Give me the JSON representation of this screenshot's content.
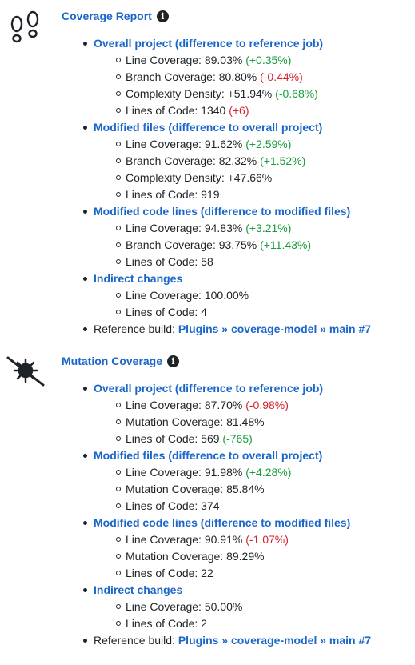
{
  "coverage": {
    "title": "Coverage Report",
    "icon": "footsteps-icon",
    "groups": [
      {
        "title": "Overall project (difference to reference job)",
        "items": [
          {
            "label": "Line Coverage: 89.03%",
            "delta": "(+0.35%)",
            "tone": "pos"
          },
          {
            "label": "Branch Coverage: 80.80%",
            "delta": "(-0.44%)",
            "tone": "neg"
          },
          {
            "label": "Complexity Density: +51.94%",
            "delta": "(-0.68%)",
            "tone": "pos"
          },
          {
            "label": "Lines of Code: 1340",
            "delta": "(+6)",
            "tone": "neg"
          }
        ]
      },
      {
        "title": "Modified files (difference to overall project)",
        "items": [
          {
            "label": "Line Coverage: 91.62%",
            "delta": "(+2.59%)",
            "tone": "pos"
          },
          {
            "label": "Branch Coverage: 82.32%",
            "delta": "(+1.52%)",
            "tone": "pos"
          },
          {
            "label": "Complexity Density: +47.66%",
            "delta": "",
            "tone": ""
          },
          {
            "label": "Lines of Code: 919",
            "delta": "",
            "tone": ""
          }
        ]
      },
      {
        "title": "Modified code lines (difference to modified files)",
        "items": [
          {
            "label": "Line Coverage: 94.83%",
            "delta": "(+3.21%)",
            "tone": "pos"
          },
          {
            "label": "Branch Coverage: 93.75%",
            "delta": "(+11.43%)",
            "tone": "pos"
          },
          {
            "label": "Lines of Code: 58",
            "delta": "",
            "tone": ""
          }
        ]
      },
      {
        "title": "Indirect changes",
        "items": [
          {
            "label": "Line Coverage: 100.00%",
            "delta": "",
            "tone": ""
          },
          {
            "label": "Lines of Code: 4",
            "delta": "",
            "tone": ""
          }
        ]
      }
    ],
    "reference_label": "Reference build: ",
    "reference_link": "Plugins » coverage-model » main #7"
  },
  "mutation": {
    "title": "Mutation Coverage",
    "icon": "virus-slash-icon",
    "groups": [
      {
        "title": "Overall project (difference to reference job)",
        "items": [
          {
            "label": "Line Coverage: 87.70%",
            "delta": "(-0.98%)",
            "tone": "neg"
          },
          {
            "label": "Mutation Coverage: 81.48%",
            "delta": "",
            "tone": ""
          },
          {
            "label": "Lines of Code: 569",
            "delta": "(-765)",
            "tone": "pos"
          }
        ]
      },
      {
        "title": "Modified files (difference to overall project)",
        "items": [
          {
            "label": "Line Coverage: 91.98%",
            "delta": "(+4.28%)",
            "tone": "pos"
          },
          {
            "label": "Mutation Coverage: 85.84%",
            "delta": "",
            "tone": ""
          },
          {
            "label": "Lines of Code: 374",
            "delta": "",
            "tone": ""
          }
        ]
      },
      {
        "title": "Modified code lines (difference to modified files)",
        "items": [
          {
            "label": "Line Coverage: 90.91%",
            "delta": "(-1.07%)",
            "tone": "neg"
          },
          {
            "label": "Mutation Coverage: 89.29%",
            "delta": "",
            "tone": ""
          },
          {
            "label": "Lines of Code: 22",
            "delta": "",
            "tone": ""
          }
        ]
      },
      {
        "title": "Indirect changes",
        "items": [
          {
            "label": "Line Coverage: 50.00%",
            "delta": "",
            "tone": ""
          },
          {
            "label": "Lines of Code: 2",
            "delta": "",
            "tone": ""
          }
        ]
      }
    ],
    "reference_label": "Reference build: ",
    "reference_link": "Plugins » coverage-model » main #7"
  },
  "info_glyph": "i",
  "colors": {
    "link": "#1a66c9",
    "positive": "#1a9c3e",
    "negative": "#d1242f"
  }
}
